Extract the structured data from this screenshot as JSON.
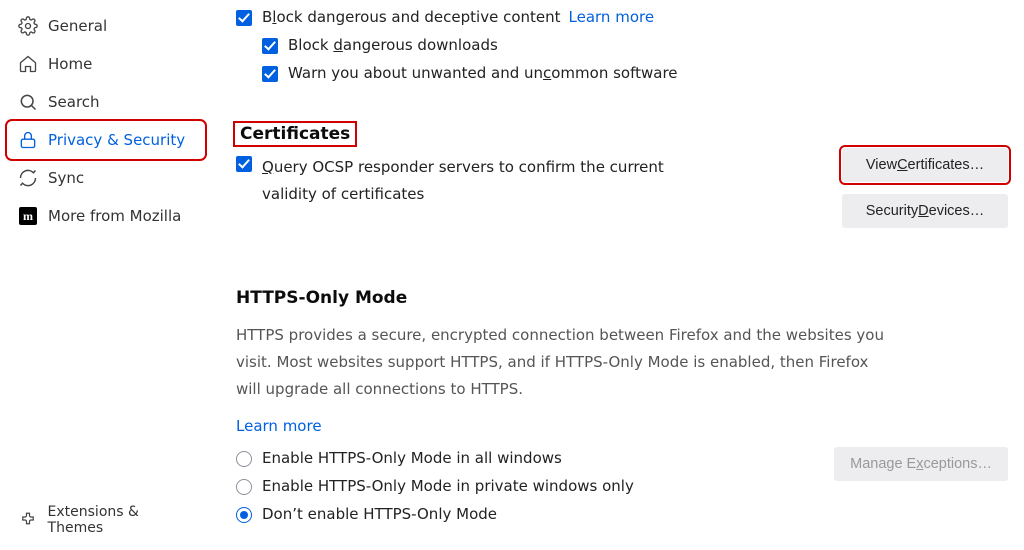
{
  "sidebar": {
    "items": [
      {
        "label": "General"
      },
      {
        "label": "Home"
      },
      {
        "label": "Search"
      },
      {
        "label": "Privacy & Security"
      },
      {
        "label": "Sync"
      },
      {
        "label": "More from Mozilla"
      }
    ],
    "bottom": {
      "label": "Extensions & Themes"
    }
  },
  "deceptive": {
    "block_pre": "B",
    "block_u": "l",
    "block_post": "ock dangerous and deceptive content",
    "learn": "Learn more",
    "downloads_pre": "Block ",
    "downloads_u": "d",
    "downloads_post": "angerous downloads",
    "uncommon_pre": "Warn you about unwanted and un",
    "uncommon_u": "c",
    "uncommon_post": "ommon software"
  },
  "cert": {
    "title": "Certificates",
    "ocsp_pre": "",
    "ocsp_u": "Q",
    "ocsp_post": "uery OCSP responder servers to confirm the current validity of certificates",
    "view_pre": "View ",
    "view_u": "C",
    "view_post": "ertificates…",
    "devices_pre": "Security ",
    "devices_u": "D",
    "devices_post": "evices…"
  },
  "https": {
    "title": "HTTPS-Only Mode",
    "desc": "HTTPS provides a secure, encrypted connection between Firefox and the websites you visit. Most websites support HTTPS, and if HTTPS-Only Mode is enabled, then Firefox will upgrade all connections to HTTPS.",
    "learn": "Learn more",
    "r1": "Enable HTTPS-Only Mode in all windows",
    "r2": "Enable HTTPS-Only Mode in private windows only",
    "r3": "Don’t enable HTTPS-Only Mode",
    "exceptions_pre": "Manage E",
    "exceptions_u": "x",
    "exceptions_post": "ceptions…"
  }
}
